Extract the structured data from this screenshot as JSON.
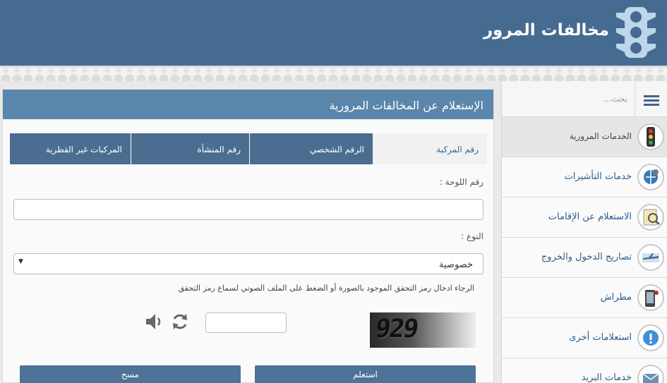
{
  "header": {
    "title": "مخالفات المرور"
  },
  "main": {
    "title": "الإستعلام عن المخالفات المرورية",
    "tabs": [
      "رقم المركبة",
      "الرقم الشخصي",
      "رقم المنشأة",
      "المركبات غير القطرية"
    ],
    "plate_label": "رقم اللوحة :",
    "plate_value": "",
    "type_label": "النوع :",
    "type_value": "خصوصية",
    "captcha_hint": "الرجاء ادخال رمز التحقق الموجود بالصورة أو الضغط على الملف الصوتي لسماع رمز التحقق",
    "captcha_text": "929",
    "captcha_value": "",
    "submit_label": "استعلم",
    "clear_label": "مسح"
  },
  "sidebar": {
    "search_placeholder": "بحث...",
    "items": [
      {
        "label": "الخدمات المرورية",
        "icon": "traffic-light-icon"
      },
      {
        "label": "خدمات التأشيرات",
        "icon": "globe-icon"
      },
      {
        "label": "الاستعلام عن الإقامات",
        "icon": "magnifier-icon"
      },
      {
        "label": "تصاريح الدخول والخروج",
        "icon": "airplane-icon"
      },
      {
        "label": "مطراش",
        "icon": "phone-icon"
      },
      {
        "label": "استعلامات أخرى",
        "icon": "info-icon"
      },
      {
        "label": "خدمات البريد",
        "icon": "mail-icon"
      }
    ]
  },
  "colors": {
    "header": "#466b90",
    "accent": "#5b86ab",
    "tab": "#4a6d90",
    "link": "#2a5e8c"
  }
}
